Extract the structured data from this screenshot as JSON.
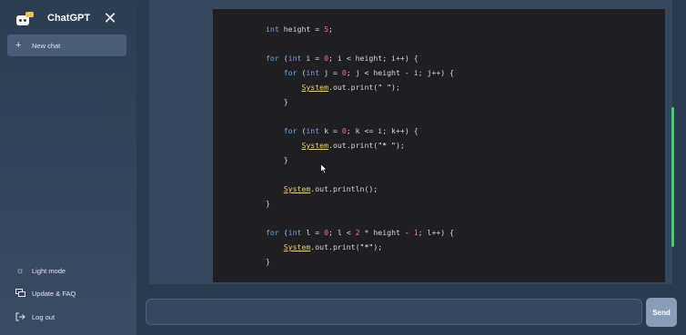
{
  "sidebar": {
    "app_title": "ChatGPT",
    "close_icon": "close-icon",
    "new_chat_label": "New chat",
    "menu": [
      {
        "label": "Light mode",
        "icon": "sun-icon"
      },
      {
        "label": "Update & FAQ",
        "icon": "chat-bubbles-icon"
      },
      {
        "label": "Log out",
        "icon": "logout-icon"
      }
    ]
  },
  "code": {
    "lines": [
      "int height = 5;",
      "",
      "for (int i = 0; i < height; i++) {",
      "    for (int j = 0; j < height - i; j++) {",
      "        System.out.print(\" \");",
      "    }",
      "",
      "    for (int k = 0; k <= i; k++) {",
      "        System.out.print(\"* \");",
      "    }",
      "",
      "    System.out.println();",
      "}",
      "",
      "for (int l = 0; l < 2 * height - 1; l++) {",
      "    System.out.print(\"*\");",
      "}"
    ]
  },
  "input": {
    "value": "",
    "placeholder": ""
  },
  "send_label": "Send",
  "colors": {
    "sidebar_bg": "#2c3d52",
    "code_bg": "#1f1f23",
    "keyword": "#6ea7e6",
    "number": "#ff6b81",
    "class_name": "#f2d15e",
    "scrollbar": "#3fd26b",
    "send_button": "#8a9db8"
  }
}
